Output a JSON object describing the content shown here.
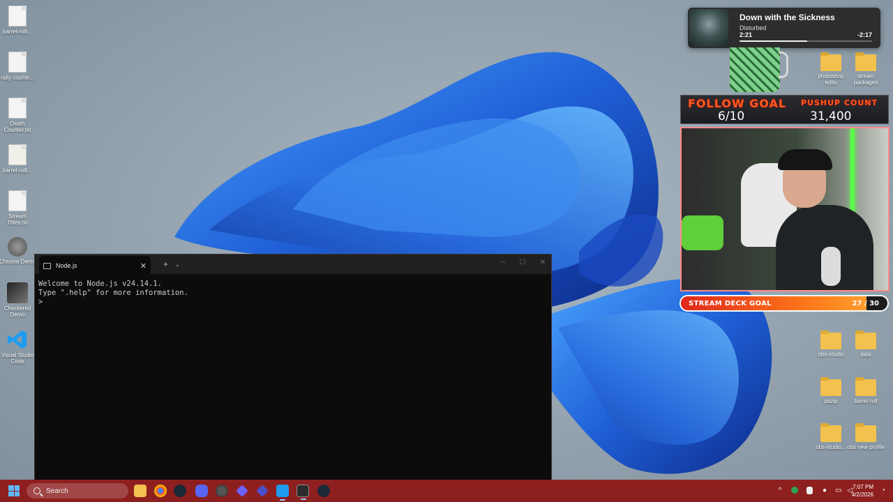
{
  "desktop": {
    "left_icons": [
      {
        "label": "barrel-rolli...",
        "kind": "doc"
      },
      {
        "label": "rally counte...",
        "kind": "doc"
      },
      {
        "label": "Death Counter.txt",
        "kind": "doc"
      },
      {
        "label": "barrel-rolli...",
        "kind": "json"
      },
      {
        "label": "Stream Titles.txt",
        "kind": "doc"
      },
      {
        "label": "Chrome Demo",
        "kind": "app"
      },
      {
        "label": "Checkered Demo",
        "kind": "app"
      },
      {
        "label": "Visual Studio Code",
        "kind": "vscode"
      }
    ],
    "right_icons": [
      {
        "label": "photoshop edits",
        "kind": "folder"
      },
      {
        "label": "stream packages",
        "kind": "folder"
      },
      {
        "label": "obs-studio",
        "kind": "folder"
      },
      {
        "label": "data",
        "kind": "folder"
      },
      {
        "label": "pazip",
        "kind": "folder"
      },
      {
        "label": "barrel roll",
        "kind": "folder"
      },
      {
        "label": "obs-studio...",
        "kind": "folder"
      },
      {
        "label": "obs new profile",
        "kind": "folder"
      }
    ]
  },
  "terminal": {
    "tab_title": "Node.js",
    "close_glyph": "✕",
    "new_tab_glyph": "+",
    "dropdown_glyph": "⌄",
    "lines": [
      "Welcome to Node.js v24.14.1.",
      "Type \".help\" for more information.",
      ">"
    ]
  },
  "now_playing": {
    "title": "Down with the Sickness",
    "artist": "Disturbed",
    "elapsed": "2:21",
    "remaining": "-2:17",
    "progress": 0.51
  },
  "goals": {
    "follow_title": "FOLLOW GOAL",
    "follow_value": "6/10",
    "pushup_title": "PUSHUP COUNT",
    "pushup_value": "31,400",
    "deck_title": "STREAM DECK GOAL",
    "deck_count": "27 / 30",
    "deck_progress": 0.9
  },
  "taskbar": {
    "search_placeholder": "Search",
    "time": "7:07 PM",
    "date": "4/2/2026"
  },
  "colors": {
    "taskbar": "#8e1f1f",
    "goal_orange": "#ff5a1f",
    "terminal_bg": "#0c0c0c"
  }
}
